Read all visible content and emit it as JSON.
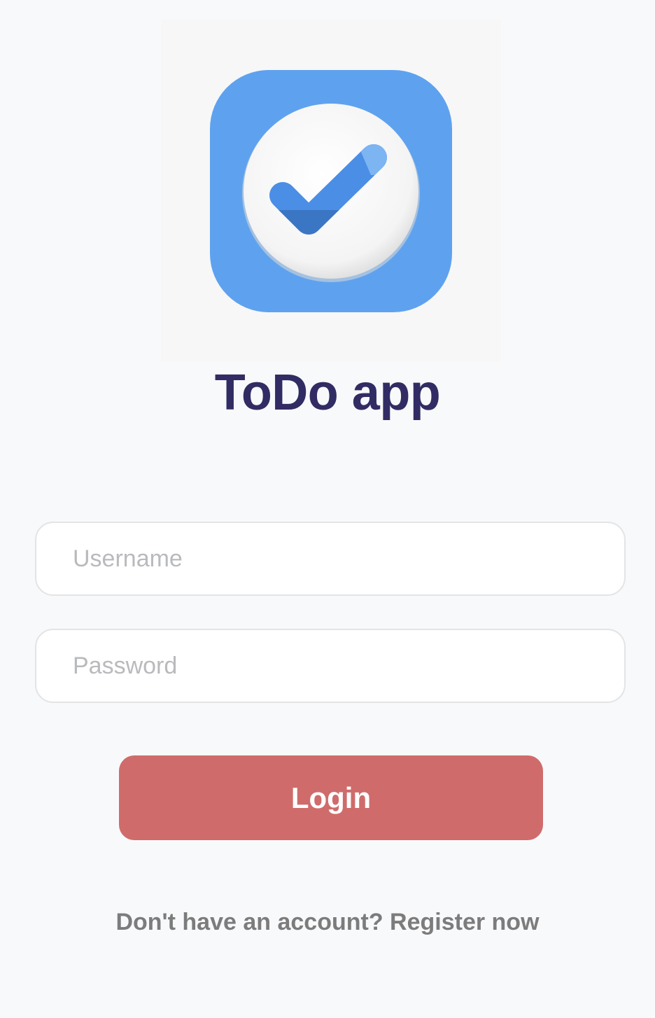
{
  "app": {
    "title": "ToDo app",
    "logo_icon": "checkmark-circle-icon",
    "colors": {
      "background": "#f8f9fb",
      "icon_background": "#5ea2ef",
      "title": "#312c63",
      "login_button": "#cf6c6b",
      "footer_text": "#7c7c7c"
    }
  },
  "form": {
    "username_placeholder": "Username",
    "password_placeholder": "Password",
    "login_label": "Login"
  },
  "footer": {
    "prompt": "Don't have an account?",
    "register_link": "Register now"
  }
}
